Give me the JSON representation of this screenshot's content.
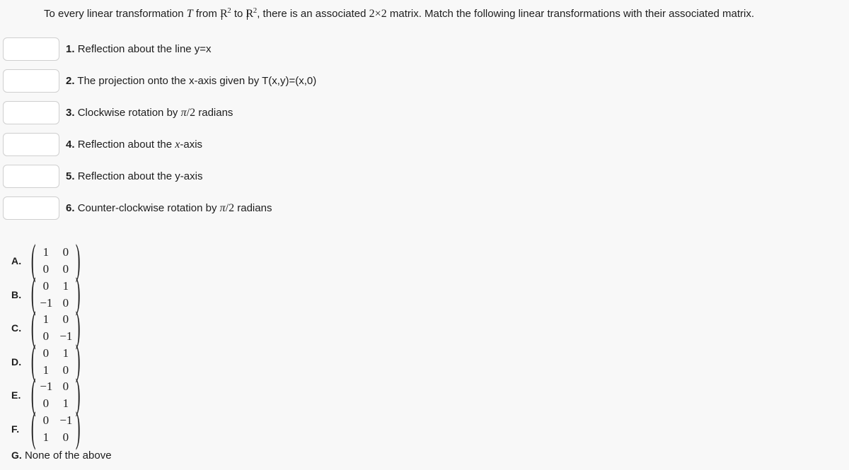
{
  "prompt": {
    "part1": "To every linear transformation ",
    "symbol_T": "T",
    "part2": " from ",
    "symbol_R1": "R",
    "exp1": "2",
    "part3": " to ",
    "symbol_R2": "R",
    "exp2": "2",
    "part4": ", there is an associated ",
    "dim_a": "2",
    "times": "×",
    "dim_b": "2",
    "part5": " matrix. Match the following linear transformations with their associated matrix."
  },
  "match_rows": [
    {
      "number": "1.",
      "text": "Reflection about the line y=x",
      "value": "",
      "placeholder": ""
    },
    {
      "number": "2.",
      "text": "The projection onto the x-axis given by T(x,y)=(x,0)",
      "value": "",
      "placeholder": ""
    },
    {
      "number": "3.",
      "text_pre": "Clockwise rotation by ",
      "text_frac_num": "π",
      "text_frac_den": "2",
      "text_post": " radians",
      "value": "",
      "placeholder": ""
    },
    {
      "number": "4.",
      "text_pre": "Reflection about the ",
      "text_italic": "x",
      "text_post": "-axis",
      "value": "",
      "placeholder": ""
    },
    {
      "number": "5.",
      "text": "Reflection about the y-axis",
      "value": "",
      "placeholder": ""
    },
    {
      "number": "6.",
      "text_pre": "Counter-clockwise rotation by ",
      "text_frac_num": "π",
      "text_frac_den": "2",
      "text_post": " radians",
      "value": "",
      "placeholder": ""
    }
  ],
  "options": [
    {
      "letter": "A.",
      "matrix": [
        "1",
        "0",
        "0",
        "0"
      ]
    },
    {
      "letter": "B.",
      "matrix": [
        "0",
        "1",
        "−1",
        "0"
      ]
    },
    {
      "letter": "C.",
      "matrix": [
        "1",
        "0",
        "0",
        "−1"
      ]
    },
    {
      "letter": "D.",
      "matrix": [
        "0",
        "1",
        "1",
        "0"
      ]
    },
    {
      "letter": "E.",
      "matrix": [
        "−1",
        "0",
        "0",
        "1"
      ]
    },
    {
      "letter": "F.",
      "matrix": [
        "0",
        "−1",
        "1",
        "0"
      ]
    }
  ],
  "option_g": {
    "letter": "G.",
    "text": " None of the above"
  },
  "colors": {
    "page_background": "#f8f8f8",
    "input_background": "#ffffff",
    "input_border": "#cfcfcf",
    "text": "#1d1d1d"
  }
}
